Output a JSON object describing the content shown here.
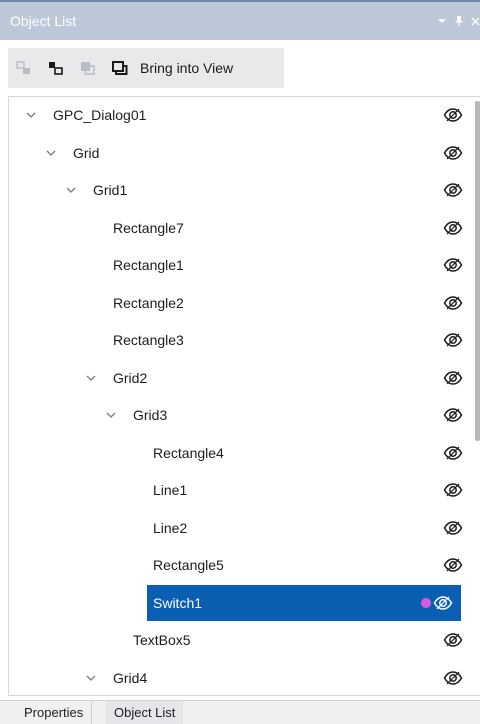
{
  "titlebar": {
    "title": "Object List",
    "controls": [
      "dropdown-icon",
      "pin-icon",
      "close-icon"
    ]
  },
  "toolbar": {
    "buttons": [
      "ungroup-icon",
      "group-icon",
      "send-to-back-icon",
      "bring-to-front-icon"
    ],
    "bring_into_view_label": "Bring into View"
  },
  "tree": {
    "items": [
      {
        "label": "GPC_Dialog01",
        "level": 0,
        "expandable": true
      },
      {
        "label": "Grid",
        "level": 1,
        "expandable": true
      },
      {
        "label": "Grid1",
        "level": 2,
        "expandable": true
      },
      {
        "label": "Rectangle7",
        "level": 3,
        "expandable": false
      },
      {
        "label": "Rectangle1",
        "level": 3,
        "expandable": false
      },
      {
        "label": "Rectangle2",
        "level": 3,
        "expandable": false
      },
      {
        "label": "Rectangle3",
        "level": 3,
        "expandable": false
      },
      {
        "label": "Grid2",
        "level": 3,
        "expandable": true
      },
      {
        "label": "Grid3",
        "level": 4,
        "expandable": true
      },
      {
        "label": "Rectangle4",
        "level": 5,
        "expandable": false
      },
      {
        "label": "Line1",
        "level": 5,
        "expandable": false
      },
      {
        "label": "Line2",
        "level": 5,
        "expandable": false
      },
      {
        "label": "Rectangle5",
        "level": 5,
        "expandable": false
      },
      {
        "label": "Switch1",
        "level": 5,
        "expandable": false,
        "selected": true,
        "marker": true
      },
      {
        "label": "TextBox5",
        "level": 4,
        "expandable": false
      },
      {
        "label": "Grid4",
        "level": 3,
        "expandable": true
      }
    ],
    "visibility_icon": "eye-icon",
    "marker_color": "#d25ee0",
    "selection_color": "#0b5fb3"
  },
  "tabs": {
    "properties_label": "Properties",
    "object_list_label": "Object List",
    "active": "Object List"
  }
}
